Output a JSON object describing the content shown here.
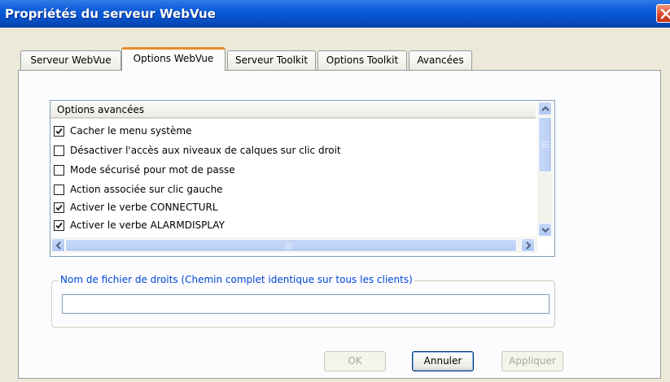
{
  "window": {
    "title": "Propriétés du serveur WebVue",
    "close_icon": "close-icon"
  },
  "tabs": [
    {
      "label": "Serveur WebVue",
      "active": false
    },
    {
      "label": "Options WebVue",
      "active": true
    },
    {
      "label": "Serveur Toolkit",
      "active": false
    },
    {
      "label": "Options Toolkit",
      "active": false
    },
    {
      "label": "Avancées",
      "active": false
    }
  ],
  "options_list": {
    "header": "Options avancées",
    "items": [
      {
        "label": "Cacher le menu système",
        "checked": true
      },
      {
        "label": "Désactiver l'accès aux niveaux de calques sur clic droit",
        "checked": false
      },
      {
        "label": "Mode sécurisé pour mot de passe",
        "checked": false
      },
      {
        "label": "Action associée sur clic gauche",
        "checked": false
      },
      {
        "label": "Activer le verbe CONNECTURL",
        "checked": true
      },
      {
        "label": "Activer le verbe ALARMDISPLAY",
        "checked": true
      }
    ]
  },
  "rights_file": {
    "label": "Nom de fichier de droits (Chemin complet identique sur tous les clients)",
    "value": ""
  },
  "buttons": {
    "ok": "OK",
    "cancel": "Annuler",
    "apply": "Appliquer"
  },
  "colors": {
    "title_bar": "#0A5AD8",
    "active_tab_accent": "#E68B2C",
    "group_label": "#0046D5",
    "close_button": "#D9452A"
  }
}
